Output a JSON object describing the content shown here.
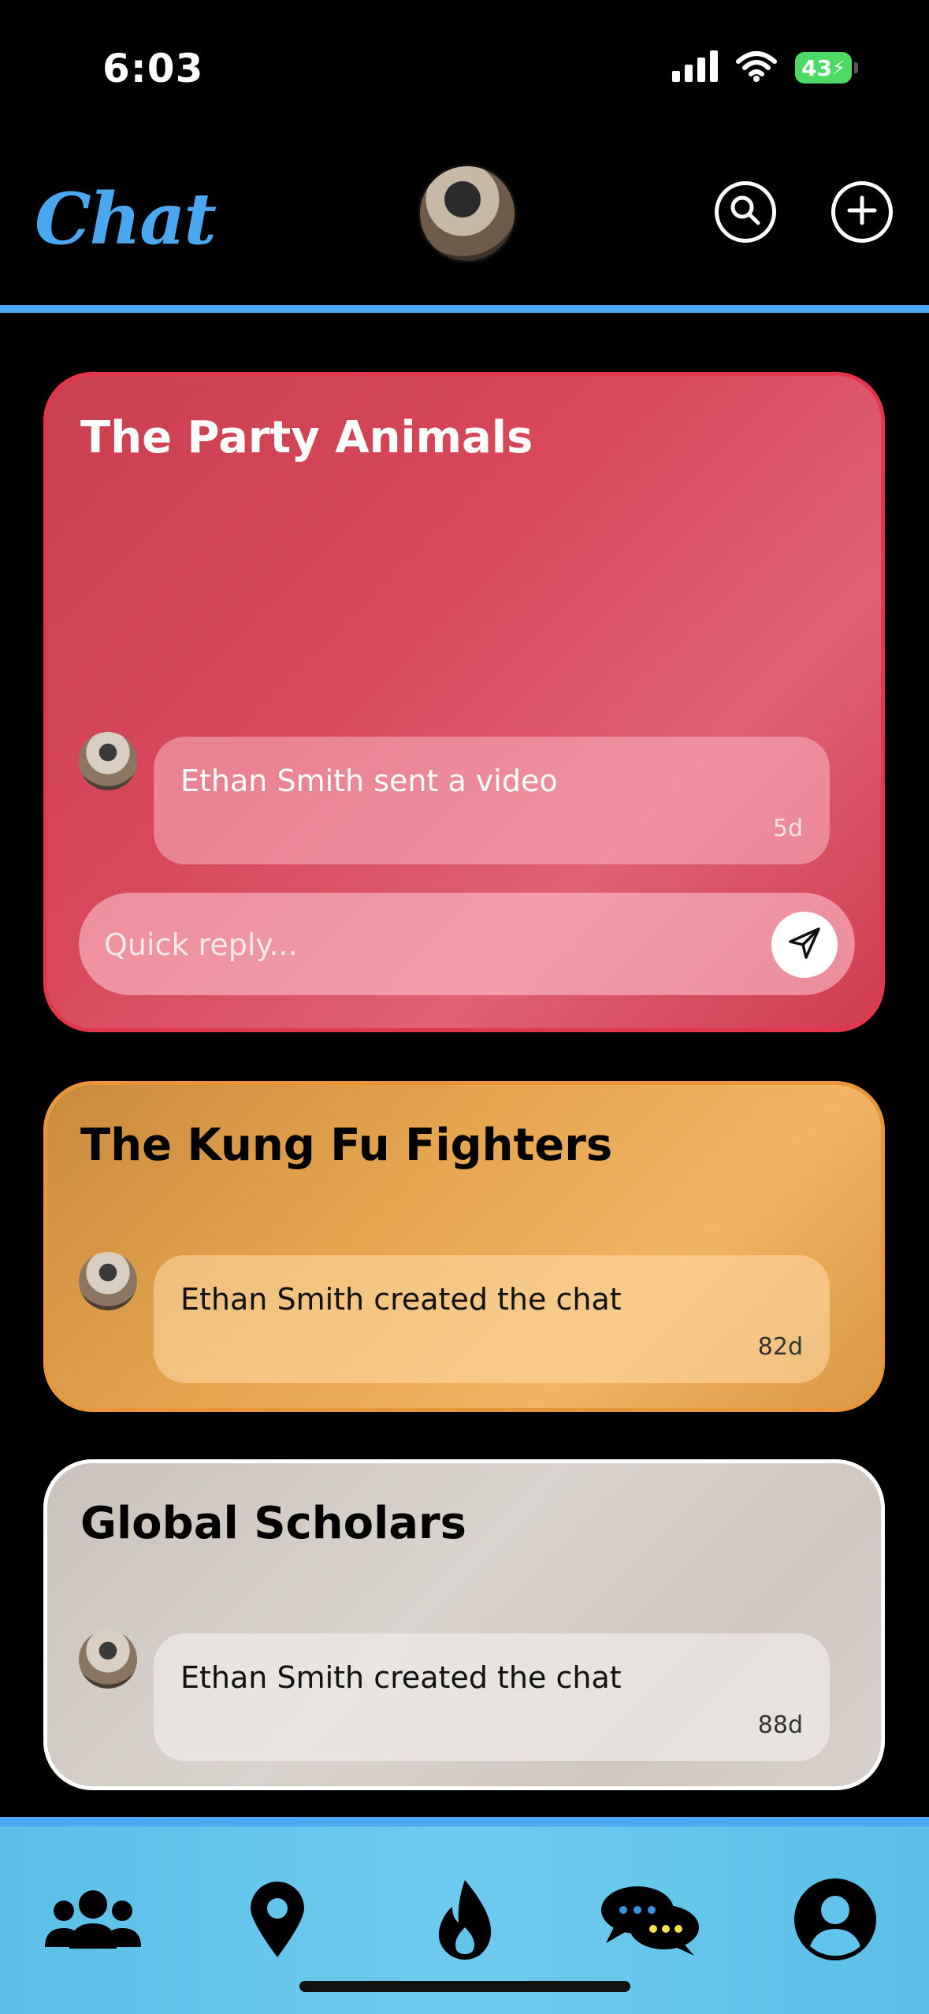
{
  "status": {
    "time": "6:03",
    "battery": "43"
  },
  "header": {
    "logo": "Chat"
  },
  "chats": [
    {
      "title": "The Party Animals",
      "preview": "Ethan Smith sent a video",
      "time": "5d",
      "quick_reply_placeholder": "Quick reply...",
      "color": "#d63d4e"
    },
    {
      "title": "The Kung Fu Fighters",
      "preview": "Ethan Smith created the chat",
      "time": "82d",
      "color": "#e3a14e"
    },
    {
      "title": "Global Scholars",
      "preview": "Ethan Smith created the chat",
      "time": "88d",
      "color": "#d9d3ce"
    }
  ],
  "nav": {
    "items": [
      "people-icon",
      "map-pin-icon",
      "flame-icon",
      "chat-bubbles-icon",
      "profile-icon"
    ]
  },
  "colors": {
    "accent": "#4ba8f0",
    "nav_bg": "#65c6ec"
  }
}
